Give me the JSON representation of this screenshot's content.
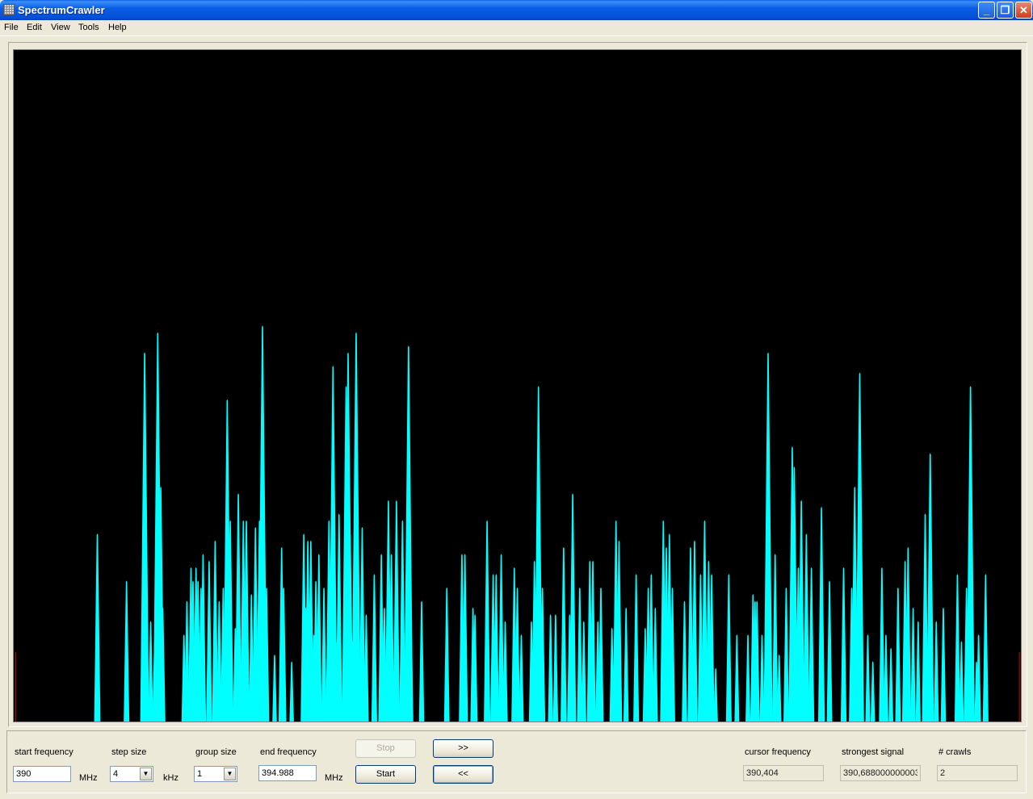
{
  "window": {
    "title": "SpectrumCrawler"
  },
  "menu": [
    "File",
    "Edit",
    "View",
    "Tools",
    "Help"
  ],
  "colors": {
    "signal": "#00ffff",
    "marker": "#cc0000",
    "plot_bg": "#000000"
  },
  "controls": {
    "start_frequency": {
      "label": "start frequency",
      "value": "390",
      "unit": "MHz"
    },
    "step_size": {
      "label": "step size",
      "value": "4",
      "unit": "kHz"
    },
    "group_size": {
      "label": "group size",
      "value": "1"
    },
    "end_frequency": {
      "label": "end frequency",
      "value": "394.988",
      "unit": "MHz"
    },
    "stop_label": "Stop",
    "start_label": "Start",
    "forward_label": ">>",
    "back_label": "<<",
    "cursor_frequency": {
      "label": "cursor frequency",
      "value": "390,404"
    },
    "strongest_signal": {
      "label": "strongest signal",
      "value": "390,688000000003"
    },
    "crawls": {
      "label": "# crawls",
      "value": "2"
    }
  },
  "spectrum": {
    "x_range": [
      0,
      1000
    ],
    "y_range": [
      0,
      100
    ],
    "markers": [
      2.1,
      998.5
    ],
    "peaks": [
      [
        83,
        28
      ],
      [
        112,
        21
      ],
      [
        130,
        55
      ],
      [
        136,
        15
      ],
      [
        140,
        12
      ],
      [
        143,
        58
      ],
      [
        146,
        35
      ],
      [
        148,
        17
      ],
      [
        169,
        13
      ],
      [
        172,
        18
      ],
      [
        176,
        23
      ],
      [
        178,
        21
      ],
      [
        181,
        23
      ],
      [
        183,
        21
      ],
      [
        186,
        20
      ],
      [
        188,
        25
      ],
      [
        194,
        24
      ],
      [
        200,
        27
      ],
      [
        204,
        18
      ],
      [
        208,
        20
      ],
      [
        212,
        48
      ],
      [
        215,
        30
      ],
      [
        220,
        14
      ],
      [
        223,
        34
      ],
      [
        228,
        30
      ],
      [
        231,
        30
      ],
      [
        236,
        19
      ],
      [
        240,
        29
      ],
      [
        244,
        30
      ],
      [
        247,
        59
      ],
      [
        251,
        20
      ],
      [
        259,
        10
      ],
      [
        266,
        26
      ],
      [
        268,
        20
      ],
      [
        276,
        9
      ],
      [
        288,
        28
      ],
      [
        290,
        17
      ],
      [
        292,
        27
      ],
      [
        295,
        27
      ],
      [
        298,
        13
      ],
      [
        300,
        21
      ],
      [
        303,
        25
      ],
      [
        308,
        20
      ],
      [
        313,
        30
      ],
      [
        317,
        53
      ],
      [
        320,
        12
      ],
      [
        323,
        31
      ],
      [
        330,
        50
      ],
      [
        332,
        55
      ],
      [
        334,
        28
      ],
      [
        336,
        12
      ],
      [
        340,
        58
      ],
      [
        346,
        29
      ],
      [
        350,
        16
      ],
      [
        358,
        22
      ],
      [
        365,
        25
      ],
      [
        368,
        17
      ],
      [
        372,
        33
      ],
      [
        375,
        25
      ],
      [
        380,
        33
      ],
      [
        386,
        30
      ],
      [
        392,
        56
      ],
      [
        394,
        20
      ],
      [
        405,
        18
      ],
      [
        430,
        20
      ],
      [
        445,
        25
      ],
      [
        448,
        25
      ],
      [
        456,
        17
      ],
      [
        458,
        16
      ],
      [
        470,
        30
      ],
      [
        476,
        22
      ],
      [
        479,
        22
      ],
      [
        484,
        25
      ],
      [
        488,
        15
      ],
      [
        497,
        23
      ],
      [
        500,
        20
      ],
      [
        504,
        13
      ],
      [
        514,
        15
      ],
      [
        517,
        24
      ],
      [
        521,
        50
      ],
      [
        525,
        20
      ],
      [
        533,
        16
      ],
      [
        538,
        16
      ],
      [
        546,
        26
      ],
      [
        552,
        16
      ],
      [
        555,
        34
      ],
      [
        562,
        20
      ],
      [
        566,
        15
      ],
      [
        572,
        24
      ],
      [
        575,
        24
      ],
      [
        580,
        15
      ],
      [
        583,
        20
      ],
      [
        594,
        14
      ],
      [
        598,
        30
      ],
      [
        601,
        27
      ],
      [
        608,
        17
      ],
      [
        618,
        22
      ],
      [
        627,
        14
      ],
      [
        630,
        20
      ],
      [
        633,
        22
      ],
      [
        637,
        17
      ],
      [
        645,
        30
      ],
      [
        648,
        26
      ],
      [
        651,
        28
      ],
      [
        654,
        20
      ],
      [
        666,
        18
      ],
      [
        672,
        26
      ],
      [
        676,
        27
      ],
      [
        682,
        22
      ],
      [
        686,
        30
      ],
      [
        690,
        24
      ],
      [
        693,
        22
      ],
      [
        697,
        8
      ],
      [
        710,
        22
      ],
      [
        718,
        13
      ],
      [
        729,
        13
      ],
      [
        734,
        19
      ],
      [
        736,
        18
      ],
      [
        738,
        18
      ],
      [
        743,
        13
      ],
      [
        749,
        55
      ],
      [
        756,
        25
      ],
      [
        760,
        10
      ],
      [
        767,
        20
      ],
      [
        773,
        41
      ],
      [
        775,
        38
      ],
      [
        779,
        23
      ],
      [
        782,
        33
      ],
      [
        787,
        28
      ],
      [
        792,
        23
      ],
      [
        802,
        32
      ],
      [
        810,
        21
      ],
      [
        824,
        23
      ],
      [
        832,
        20
      ],
      [
        835,
        35
      ],
      [
        840,
        52
      ],
      [
        848,
        13
      ],
      [
        853,
        9
      ],
      [
        862,
        23
      ],
      [
        866,
        13
      ],
      [
        871,
        11
      ],
      [
        878,
        20
      ],
      [
        885,
        24
      ],
      [
        888,
        26
      ],
      [
        893,
        17
      ],
      [
        898,
        15
      ],
      [
        905,
        31
      ],
      [
        910,
        40
      ],
      [
        916,
        15
      ],
      [
        923,
        17
      ],
      [
        937,
        22
      ],
      [
        941,
        12
      ],
      [
        946,
        20
      ],
      [
        950,
        50
      ],
      [
        956,
        9
      ],
      [
        958,
        13
      ],
      [
        965,
        22
      ]
    ]
  }
}
